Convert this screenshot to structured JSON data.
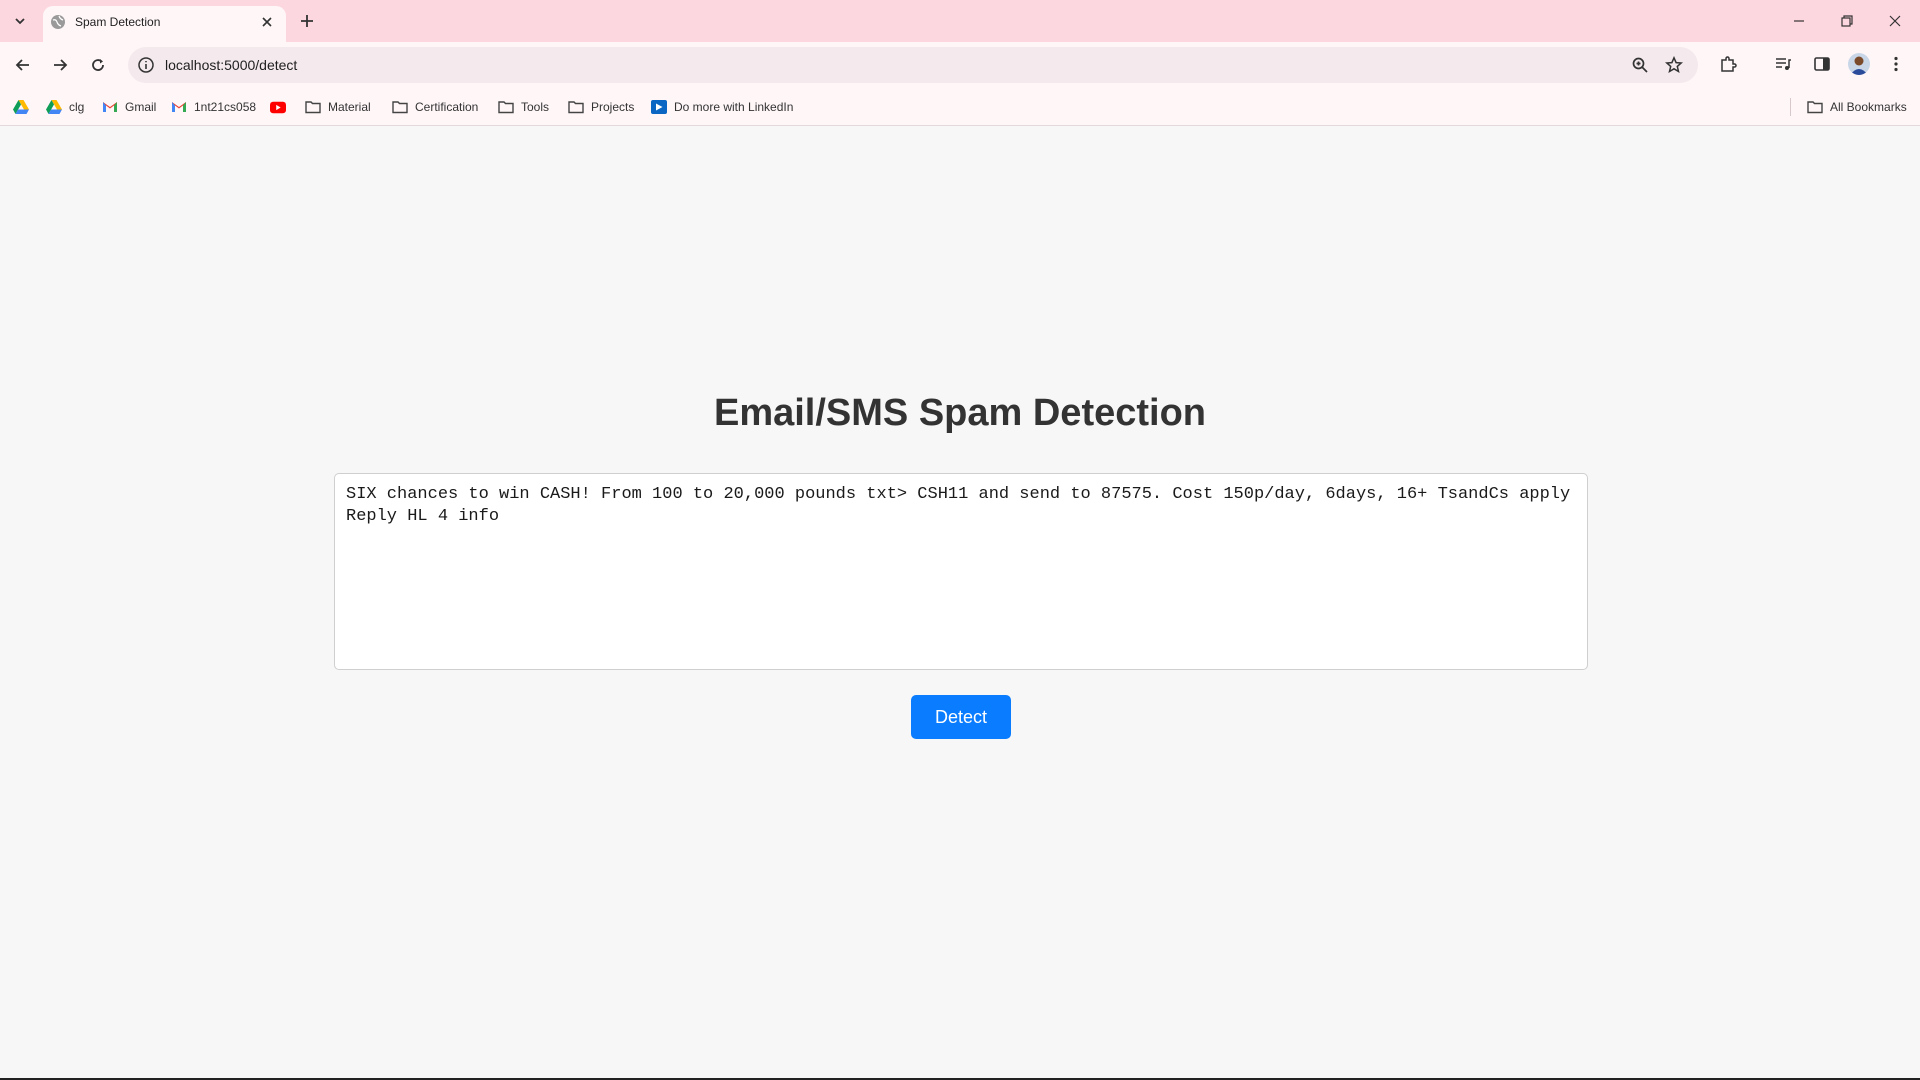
{
  "browser": {
    "tab": {
      "title": "Spam Detection"
    },
    "url": "localhost:5000/detect",
    "bookmarks": [
      {
        "label": "",
        "icon": "google-drive-icon"
      },
      {
        "label": "clg",
        "icon": "google-drive-icon"
      },
      {
        "label": "Gmail",
        "icon": "gmail-icon"
      },
      {
        "label": "1nt21cs058",
        "icon": "gmail-icon"
      },
      {
        "label": "",
        "icon": "youtube-icon"
      },
      {
        "label": "Material",
        "icon": "folder-icon"
      },
      {
        "label": "Certification",
        "icon": "folder-icon"
      },
      {
        "label": "Tools",
        "icon": "folder-icon"
      },
      {
        "label": "Projects",
        "icon": "folder-icon"
      },
      {
        "label": "Do more with LinkedIn",
        "icon": "linkedin-learning-icon"
      }
    ],
    "all_bookmarks_label": "All Bookmarks",
    "colors": {
      "tabstrip": "#fdd7e0",
      "toolbar": "#fff6f8"
    }
  },
  "page": {
    "title": "Email/SMS Spam Detection",
    "message": "SIX chances to win CASH! From 100 to 20,000 pounds txt> CSH11 and send to 87575. Cost 150p/day, 6days, 16+ TsandCs apply\nReply HL 4 info",
    "detect_label": "Detect",
    "colors": {
      "button": "#0a7cff",
      "background": "#f7f7f7"
    }
  }
}
